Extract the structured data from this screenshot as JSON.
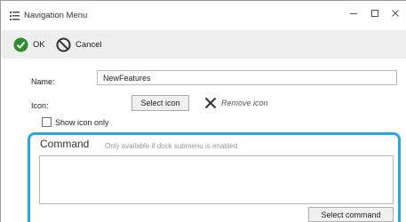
{
  "window": {
    "title": "Navigation Menu",
    "icon": "menu-list-icon",
    "controls": {
      "minimize": "minimize-icon",
      "maximize": "maximize-icon",
      "close": "close-icon"
    }
  },
  "toolbar": {
    "ok_label": "OK",
    "ok_icon": "check-circle-icon",
    "cancel_label": "Cancel",
    "cancel_icon": "cancel-circle-icon"
  },
  "form": {
    "name_label": "Name:",
    "name_value": "NewFeatures",
    "icon_label": "Icon:",
    "select_icon_label": "Select icon",
    "remove_icon_label": "Remove icon",
    "show_icon_only_label": "Show icon only",
    "show_icon_only_checked": false
  },
  "command": {
    "title": "Command",
    "hint": "Only available if dock submenu is enabled",
    "value": "",
    "select_command_label": "Select command"
  },
  "colors": {
    "accent_highlight": "#29a8e0",
    "ok_green": "#2e8b2e",
    "toolbar_bg": "#eeeeee"
  }
}
